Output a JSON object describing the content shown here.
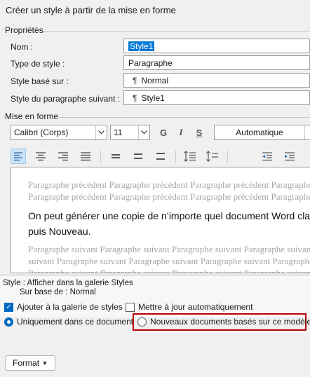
{
  "dialog": {
    "title": "Créer un style à partir de la mise en forme"
  },
  "properties": {
    "section_label": "Propriétés",
    "name_label": "Nom :",
    "name_value": "Style1",
    "type_label": "Type de style :",
    "type_value": "Paragraphe",
    "based_label": "Style basé sur :",
    "based_value": "Normal",
    "next_label": "Style du paragraphe suivant :",
    "next_value": "Style1"
  },
  "formatting": {
    "section_label": "Mise en forme",
    "font": "Calibri (Corps)",
    "size": "11",
    "bold": "G",
    "italic": "I",
    "underline": "S",
    "color": "Automatique"
  },
  "preview": {
    "prev1": "Paragraphe précédent Paragraphe précédent Paragraphe précédent Paragraphe précédent Paragraphe",
    "prev2": "Paragraphe précédent Paragraphe précédent Paragraphe précédent Paragraphe précédent Paragraphe",
    "main1": "On peut générer une copie de n’importe quel document Word classique",
    "main2": "puis Nouveau.",
    "next1": "Paragraphe suivant Paragraphe suivant Paragraphe suivant Paragraphe suivant Paragraphe suivant",
    "next2": "suivant Paragraphe suivant Paragraphe suivant Paragraphe suivant Paragraphe suivant Paragraphe",
    "next3": "Paragraphe suivant Paragraphe suivant Paragraphe suivant Paragraphe suivant Paragraphe suivant"
  },
  "description": {
    "line1": "Style : Afficher dans la galerie Styles",
    "line2": "Sur base de : Normal"
  },
  "options": {
    "add_gallery": "Ajouter à la galerie de styles",
    "auto_update": "Mettre à jour automatiquement",
    "only_doc": "Uniquement dans ce document",
    "new_docs": "Nouveaux documents basés sur ce modèle"
  },
  "buttons": {
    "format": "Format"
  },
  "colors": {
    "accent": "#0078d4",
    "highlight_box": "#c00000"
  }
}
